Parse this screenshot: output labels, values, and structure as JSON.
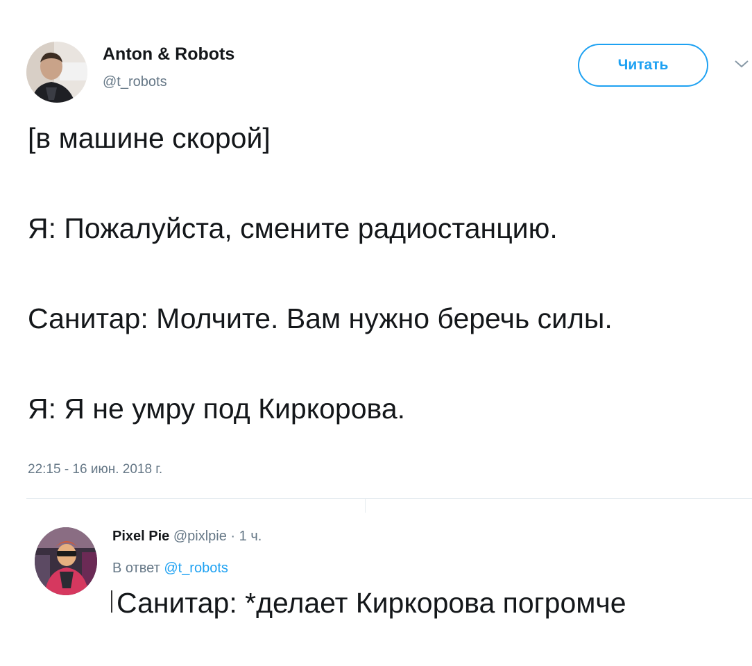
{
  "tweet": {
    "author_name": "Anton & Robots",
    "author_handle": "@t_robots",
    "follow_label": "Читать",
    "lines": [
      "[в машине скорой]",
      "Я: Пожалуйста, смените радиостанцию.",
      "Санитар: Молчите. Вам нужно беречь силы.",
      "Я: Я не умру под Киркорова."
    ],
    "timestamp": "22:15 - 16 июн. 2018 г."
  },
  "reply": {
    "author_name": "Pixel Pie",
    "author_handle": "@pixlpie",
    "separator": "·",
    "time_ago": "1 ч.",
    "reply_to_prefix": "В ответ",
    "reply_to_handle": "@t_robots",
    "text": "Санитар: *делает Киркорова погромче"
  },
  "icons": {
    "menu": "chevron-down-icon"
  },
  "colors": {
    "accent": "#1da1f2",
    "secondary_text": "#657786",
    "primary_text": "#14171a",
    "divider": "#e6ecf0"
  }
}
